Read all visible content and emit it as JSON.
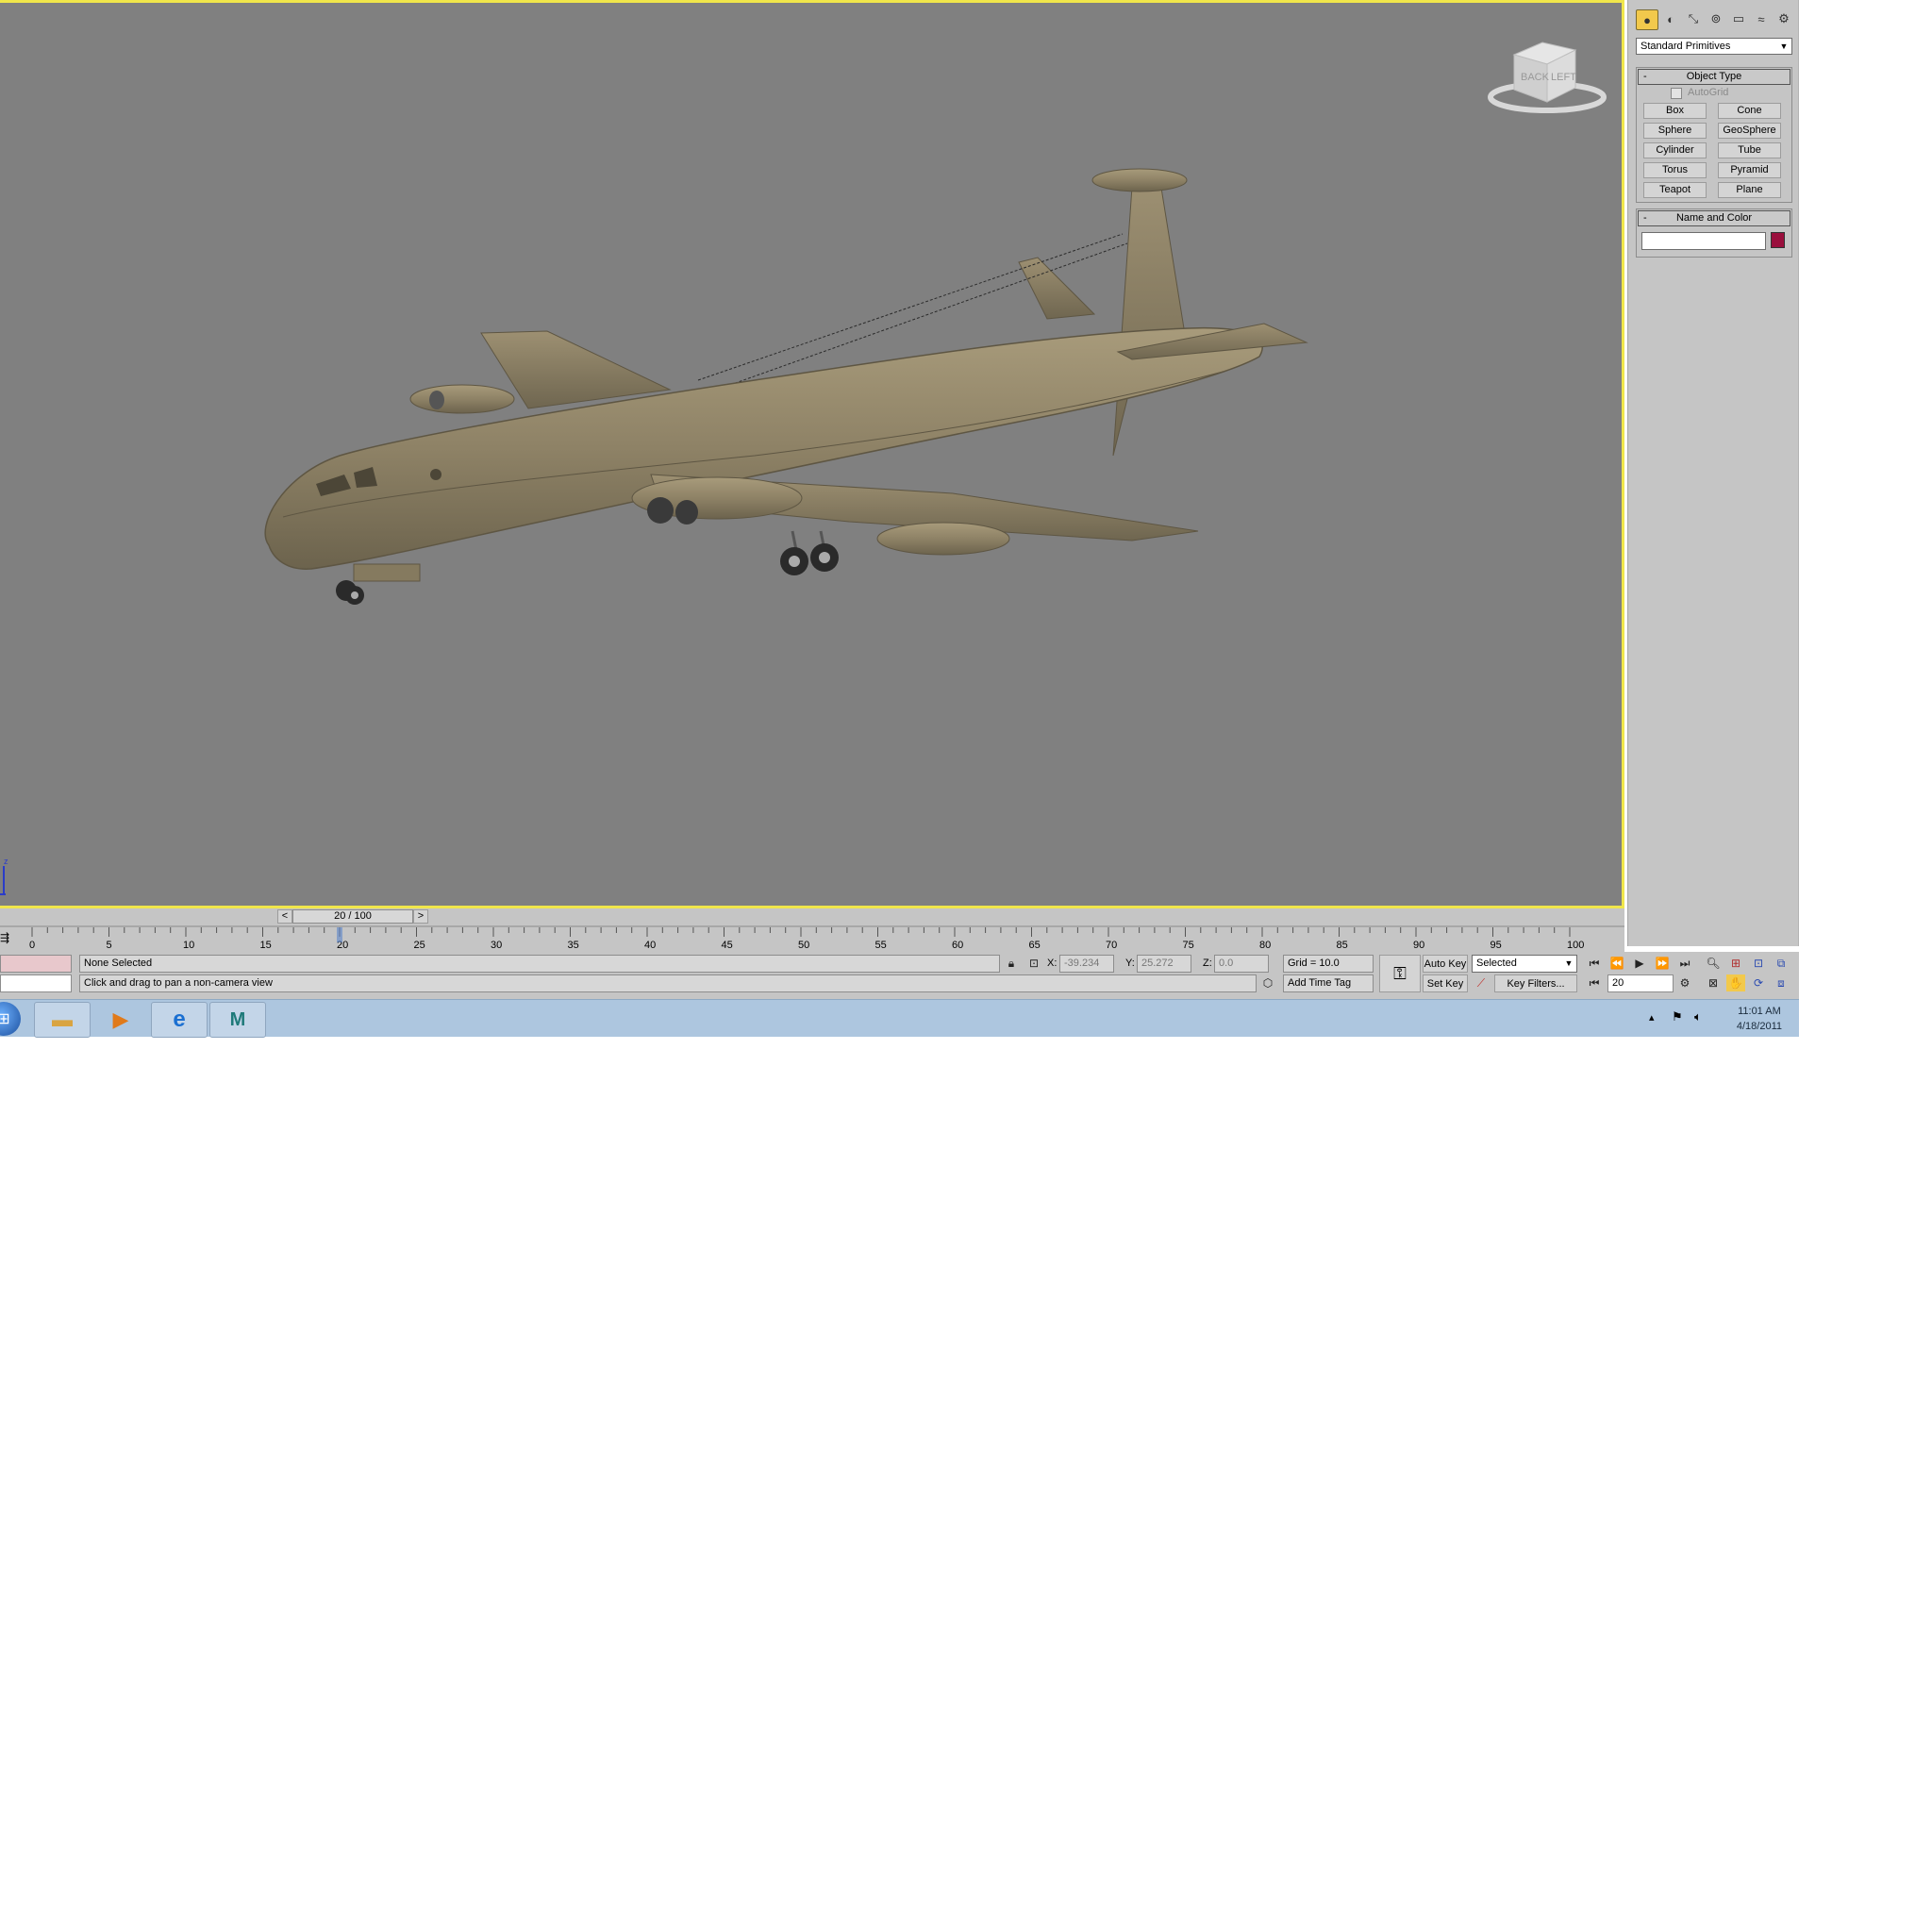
{
  "command_panel": {
    "tabs": [
      {
        "icon": "create-icon"
      },
      {
        "icon": "modify-icon"
      },
      {
        "icon": "hierarchy-icon"
      },
      {
        "icon": "motion-icon"
      },
      {
        "icon": "display-icon"
      },
      {
        "icon": "utilities-icon"
      },
      {
        "icon": "settings-icon"
      }
    ],
    "category": "Standard Primitives",
    "object_type": {
      "title": "Object Type",
      "autogrid_label": "AutoGrid",
      "buttons": [
        "Box",
        "Cone",
        "Sphere",
        "GeoSphere",
        "Cylinder",
        "Tube",
        "Torus",
        "Pyramid",
        "Teapot",
        "Plane"
      ]
    },
    "name_and_color": {
      "title": "Name and Color",
      "name_value": "",
      "color": "#9a0f3d"
    }
  },
  "viewcube": {
    "face_back": "BACK",
    "face_left": "LEFT"
  },
  "axis": {
    "z": "z"
  },
  "time_slider": {
    "label": "20 / 100",
    "prev": "<",
    "next": ">",
    "current": 20,
    "total": 100
  },
  "track_bar": {
    "tick_labels": [
      "0",
      "5",
      "10",
      "15",
      "20",
      "25",
      "30",
      "35",
      "40",
      "45",
      "50",
      "55",
      "60",
      "65",
      "70",
      "75",
      "80",
      "85",
      "90",
      "95",
      "100"
    ]
  },
  "status": {
    "selection": "None Selected",
    "prompt": "Click and drag to pan a non-camera view",
    "x_label": "X:",
    "x_value": "-39.234",
    "y_label": "Y:",
    "y_value": "25.272",
    "z_label": "Z:",
    "z_value": "0.0",
    "grid": "Grid = 10.0",
    "add_time_tag": "Add Time Tag",
    "auto_key": "Auto Key",
    "set_key": "Set Key",
    "selected_dropdown": "Selected",
    "key_filters": "Key Filters...",
    "frame_value": "20"
  },
  "taskbar": {
    "apps": [
      "windows-start-icon",
      "file-explorer-icon",
      "media-player-icon",
      "internet-explorer-icon",
      "3ds-max-icon"
    ],
    "time": "11:01 AM",
    "date": "4/18/2011"
  },
  "colors": {
    "viewport_bg": "#808080",
    "viewport_border": "#f0e64b",
    "panel_bg": "#c5c5c5",
    "aircraft": "#8b7f63",
    "taskbar": "#adc6df"
  }
}
